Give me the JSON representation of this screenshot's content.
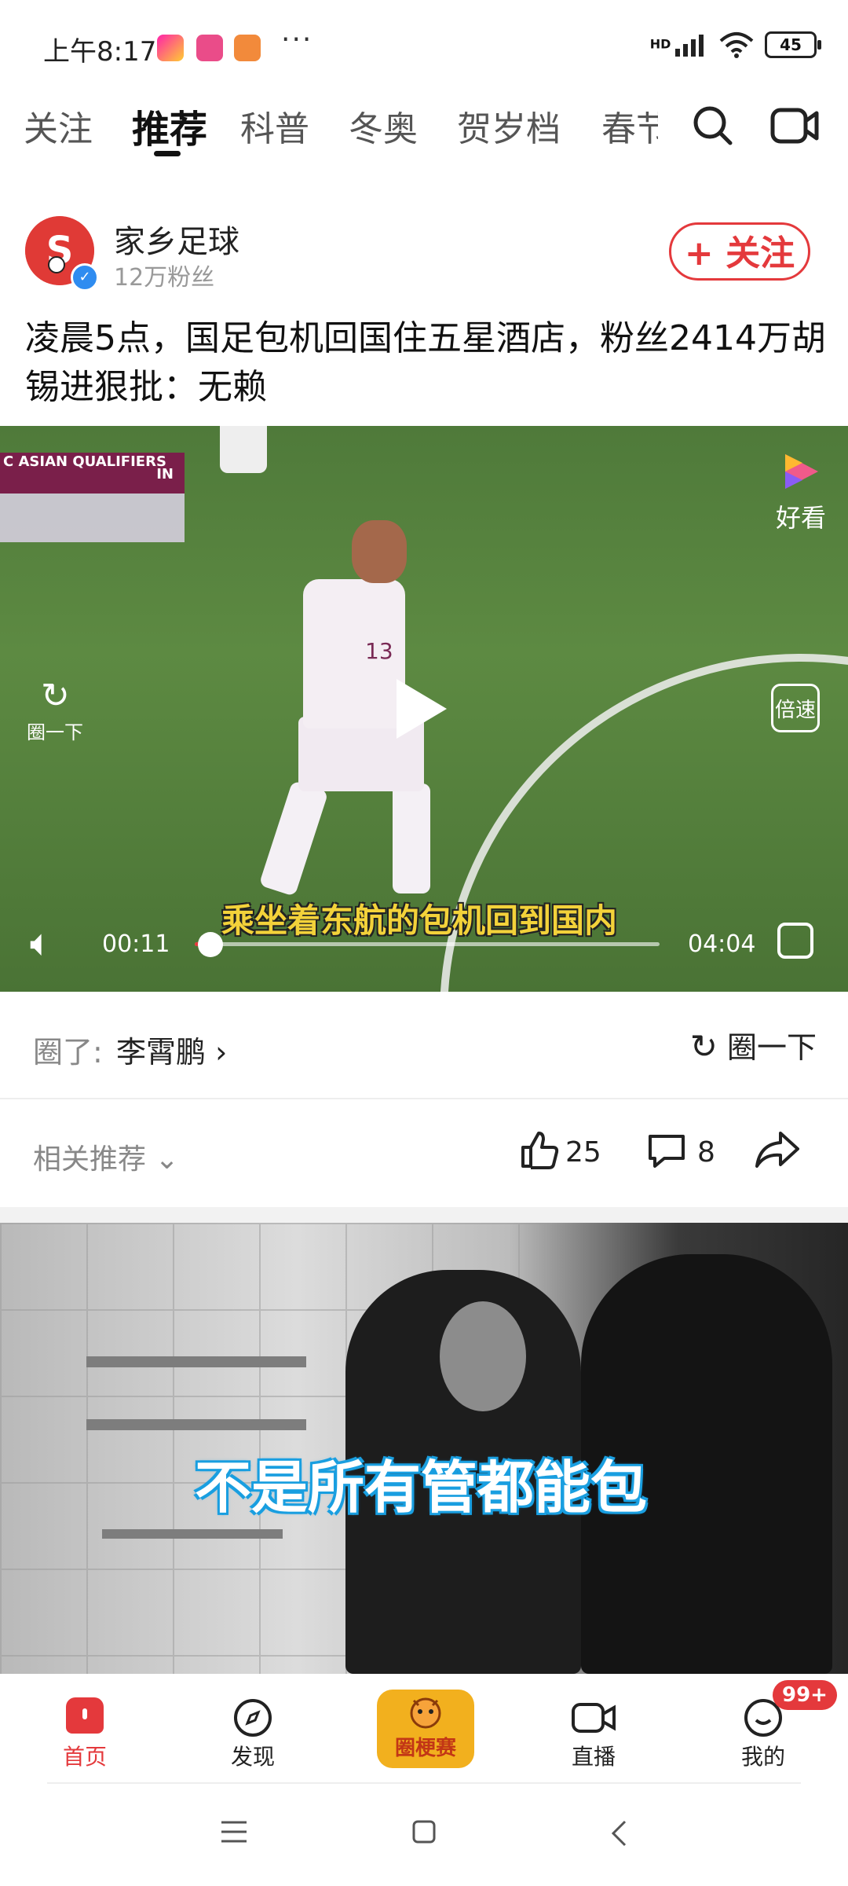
{
  "status_bar": {
    "time": "上午8:17",
    "dots": "···",
    "hd": "HD",
    "battery": "45"
  },
  "tabs": [
    "关注",
    "推荐",
    "科普",
    "冬奥",
    "贺岁档",
    "春节"
  ],
  "active_tab": "推荐",
  "post": {
    "author": "家乡足球",
    "fans": "12万粉丝",
    "follow_label": "+ 关注",
    "headline": "凌晨5点，国足包机回国住五星酒店，粉丝2414万胡锡进狠批：无赖"
  },
  "video": {
    "overlay_text": "C ASIAN QUALIFIERS",
    "overlay_code": "IN",
    "brand_label": "好看",
    "circle_label": "圈一下",
    "speed_label": "倍速",
    "subtitle": "乘坐着东航的包机回到国内",
    "current_time": "00:11",
    "total_time": "04:04",
    "progress": 0.045,
    "jersey_number": "13"
  },
  "circle_row": {
    "prefix": "圈了:",
    "name": "李霄鹏 ›",
    "button": "圈一下"
  },
  "actions": {
    "related": "相关推荐 ⌄",
    "likes": "25",
    "comments": "8"
  },
  "video2": {
    "subtitle": "不是所有管都能包"
  },
  "bottom_nav": {
    "home": "首页",
    "discover": "发现",
    "center": "圈梗赛",
    "live": "直播",
    "me": "我的",
    "badge": "99+"
  },
  "colors": {
    "accent": "#e4393c",
    "verified": "#2f8cf0",
    "subtitle_yellow": "#f3d23a"
  }
}
